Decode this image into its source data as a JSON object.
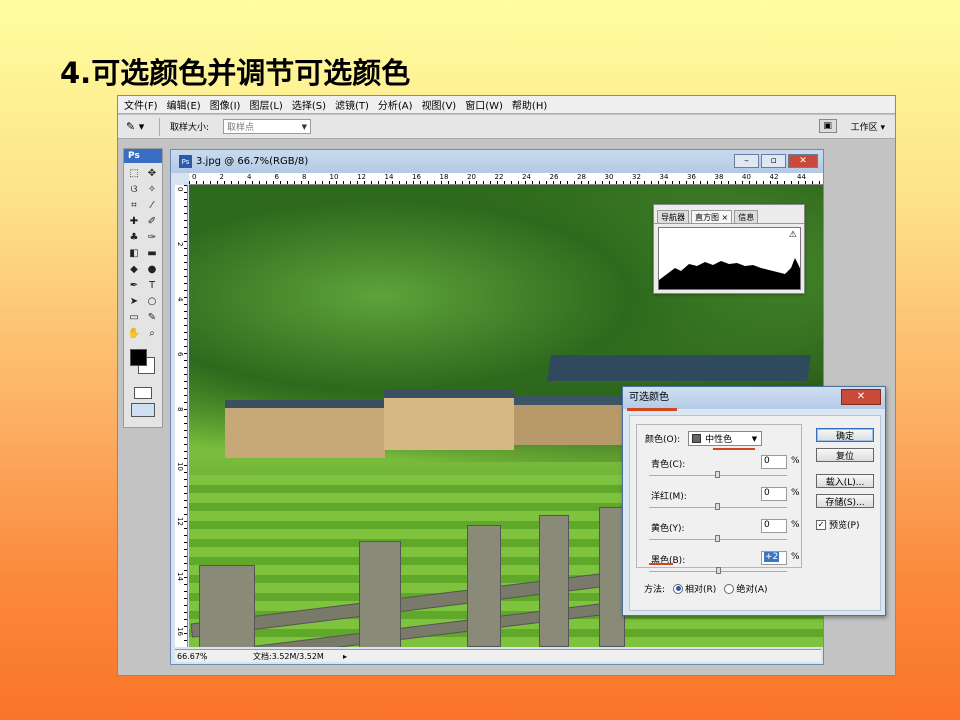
{
  "slide": {
    "title": "4.可选颜色并调节可选颜色"
  },
  "menu": [
    "文件(F)",
    "编辑(E)",
    "图像(I)",
    "图层(L)",
    "选择(S)",
    "滤镜(T)",
    "分析(A)",
    "视图(V)",
    "窗口(W)",
    "帮助(H)"
  ],
  "options": {
    "tool_icon": "eyedropper-icon",
    "sample_size_label": "取样大小:",
    "sample_size_value": "取样点",
    "workspace": "工作区 ▾"
  },
  "toolbox": {
    "logo": "Ps"
  },
  "document": {
    "title": "3.jpg @ 66.7%(RGB/8)",
    "ruler_top": [
      "0",
      "2",
      "4",
      "6",
      "8",
      "10",
      "12",
      "14",
      "16",
      "18",
      "20",
      "22",
      "24",
      "26",
      "28",
      "30",
      "32",
      "34",
      "36",
      "38",
      "40",
      "42",
      "44"
    ],
    "ruler_left": [
      "0",
      "2",
      "4",
      "6",
      "8",
      "10",
      "12",
      "14",
      "16"
    ],
    "status_zoom": "66.67%",
    "status_doc": "文档:3.52M/3.52M"
  },
  "navigator": {
    "tabs": [
      "导航器",
      "直方图 ×",
      "信息"
    ],
    "warning": "⚠"
  },
  "dialog": {
    "title": "可选颜色",
    "color_label": "颜色(O):",
    "color_value": "中性色",
    "sliders": [
      {
        "label": "青色(C):",
        "value": "0",
        "unit": "%",
        "pos": 0.5
      },
      {
        "label": "洋红(M):",
        "value": "0",
        "unit": "%",
        "pos": 0.5
      },
      {
        "label": "黄色(Y):",
        "value": "0",
        "unit": "%",
        "pos": 0.5
      },
      {
        "label": "黑色(B):",
        "value": "+2",
        "unit": "%",
        "pos": 0.51
      }
    ],
    "method_label": "方法:",
    "method_relative": "相对(R)",
    "method_absolute": "绝对(A)",
    "buttons": {
      "ok": "确定",
      "reset": "复位",
      "load": "载入(L)...",
      "save": "存储(S)..."
    },
    "preview_label": "预览(P)"
  }
}
